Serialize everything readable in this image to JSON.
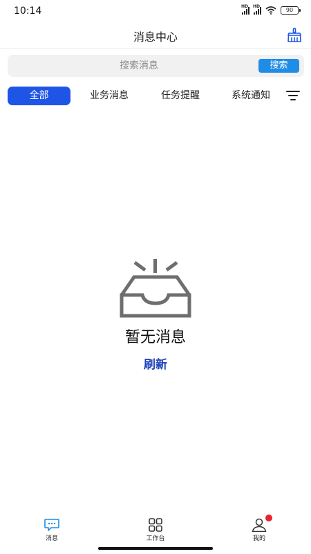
{
  "status_bar": {
    "time": "10:14",
    "sim1_label": "HD",
    "sim2_label": "HD",
    "battery": "90"
  },
  "header": {
    "title": "消息中心",
    "clear_icon": "broom-clear-icon"
  },
  "search": {
    "placeholder": "搜索消息",
    "value": "",
    "button_label": "搜索"
  },
  "tabs": [
    {
      "label": "全部",
      "active": true
    },
    {
      "label": "业务消息",
      "active": false
    },
    {
      "label": "任务提醒",
      "active": false
    },
    {
      "label": "系统通知",
      "active": false
    }
  ],
  "filter_icon": "filter-icon",
  "empty_state": {
    "icon": "empty-inbox-icon",
    "text": "暂无消息",
    "refresh_label": "刷新"
  },
  "bottom_nav": {
    "items": [
      {
        "label": "消息",
        "icon": "message-icon",
        "active": true
      },
      {
        "label": "工作台",
        "icon": "grid-icon",
        "active": false
      },
      {
        "label": "我的",
        "icon": "user-icon",
        "active": false,
        "badge": true
      }
    ]
  },
  "colors": {
    "accent": "#1f55e6",
    "search_button": "#1f8ce6",
    "refresh": "#1f44b8",
    "badge": "#e8242c"
  }
}
